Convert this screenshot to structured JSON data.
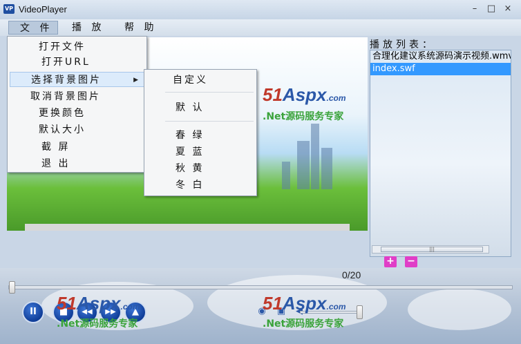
{
  "window": {
    "icon_text": "VP",
    "title": "VideoPlayer",
    "minimize": "–",
    "maximize": "□",
    "close": "×"
  },
  "menubar": {
    "file": "文 件",
    "play": "播 放",
    "help": "帮 助"
  },
  "file_menu": {
    "open_file": "打开文件",
    "open_url": "打开URL",
    "choose_bg": "选择背景图片",
    "cancel_bg": "取消背景图片",
    "change_color": "更换颜色",
    "default_size": "默认大小",
    "screenshot": "截 屏",
    "exit": "退 出"
  },
  "bg_submenu": {
    "custom": "自定义",
    "default": "默 认",
    "spring_green": "春 绿",
    "summer_blue": "夏 蓝",
    "autumn_yellow": "秋 黄",
    "winter_white": "冬 白"
  },
  "watermark": {
    "brand_a": "51",
    "brand_b": "Aspx",
    "brand_c": ".com",
    "tagline": ".Net源码服务专家"
  },
  "playlist": {
    "label": "播放列表：",
    "items": [
      "合理化建议系统源码演示视频.wmv",
      "index.swf"
    ],
    "selected_index": 1,
    "scroll_grip": "|||"
  },
  "playlist_buttons": {
    "add": "+",
    "remove": "−"
  },
  "player": {
    "time": "0/20",
    "progress": 0.0,
    "volume": 1.0,
    "buttons": {
      "play_pause": "II",
      "stop": "■",
      "prev": "◀◀",
      "next": "▶▶",
      "eject": "▲"
    },
    "icons": {
      "fullscreen": "camera-icon",
      "mute": "speaker-icon"
    }
  },
  "colors": {
    "selection": "#3399ff",
    "accent_pink": "#e03ec7",
    "control_blue": "#0f3d98"
  }
}
